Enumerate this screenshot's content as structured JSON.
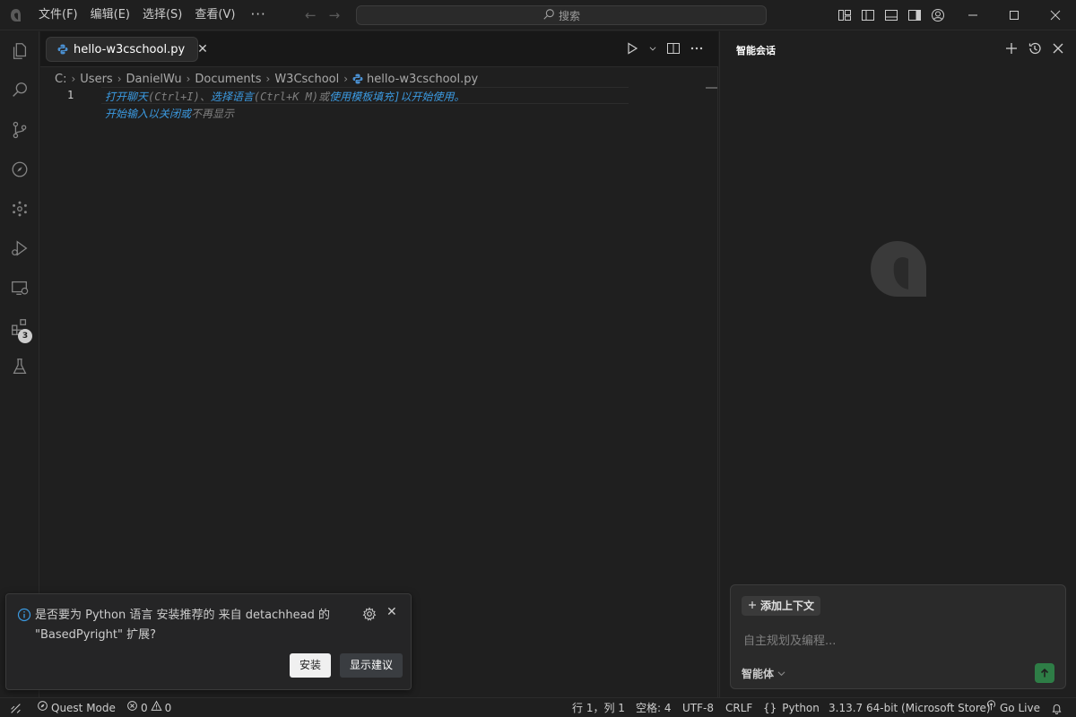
{
  "titlebar": {
    "menu": [
      "文件(F)",
      "编辑(E)",
      "选择(S)",
      "查看(V)"
    ],
    "more": "···",
    "back_arrow": "←",
    "forward_arrow": "→",
    "search_placeholder": "搜索"
  },
  "editor": {
    "tab_label": "hello-w3cschool.py",
    "tab_close": "✕",
    "breadcrumb": [
      "C:",
      "Users",
      "DanielWu",
      "Documents",
      "W3Cschool",
      "hello-w3cschool.py"
    ],
    "breadcrumb_sep": "›",
    "line_number": "1",
    "hint": {
      "open_chat": "打开聊天",
      "open_chat_key": "(Ctrl+I)",
      "sep": "、",
      "select_lang": "选择语言",
      "select_lang_key": "(Ctrl+K M)",
      "or1": "或",
      "use_template": "使用模板填充",
      "tail": "]以开始使用。",
      "start_typing": "开始输入以关闭或",
      "dont_show": "不再显示"
    }
  },
  "notification": {
    "message": "是否要为 Python 语言 安装推荐的 来自 detachhead 的 \"BasedPyright\" 扩展?",
    "close": "✕",
    "install_label": "安装",
    "suggest_label": "显示建议"
  },
  "activity_badge": "3",
  "chat": {
    "title": "智能会话",
    "add_context": "添加上下文",
    "input_placeholder": "自主规划及编程...",
    "agent_label": "智能体",
    "agent_chevron": "⌵"
  },
  "statusbar": {
    "quest_mode": "Quest Mode",
    "errors": "0",
    "warnings": "0",
    "position": "行 1，列 1",
    "spaces": "空格: 4",
    "encoding": "UTF-8",
    "eol": "CRLF",
    "language": "Python",
    "language_braces": "{}",
    "interpreter": "3.13.7 64-bit (Microsoft Store)",
    "go_live": "Go Live"
  },
  "colors": {
    "accent_link": "#3b9ae1",
    "send_button": "#2e7d46",
    "background": "#1f1f1f"
  }
}
